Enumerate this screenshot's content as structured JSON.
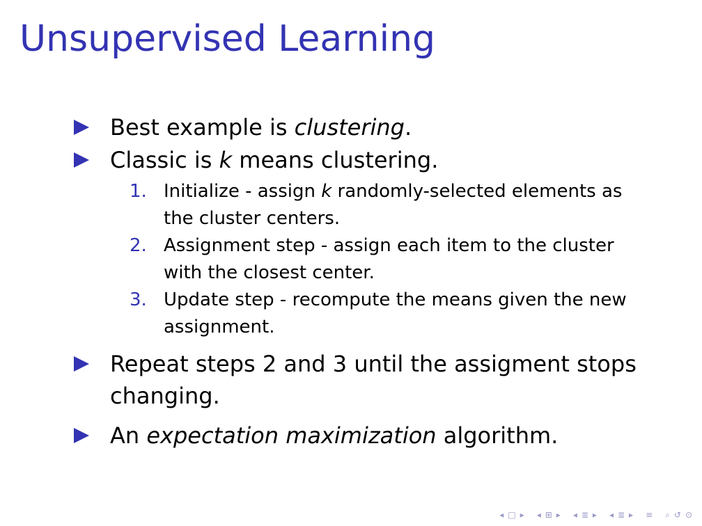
{
  "slide": {
    "title": "Unsupervised Learning",
    "bullets": [
      {
        "parts": [
          "Best example is ",
          "clustering",
          "."
        ]
      },
      {
        "parts": [
          "Classic is ",
          "k",
          " means clustering."
        ]
      },
      {
        "line1": "Repeat steps 2 and 3 until the assigment stops",
        "line2": "changing."
      },
      {
        "parts": [
          "An ",
          "expectation maximization",
          " algorithm."
        ]
      }
    ],
    "steps": [
      {
        "number": "1.",
        "line1_pre": "Initialize - assign ",
        "line1_em": "k",
        "line1_post": " randomly-selected elements as",
        "line2": "the cluster centers."
      },
      {
        "number": "2.",
        "line1": "Assignment step - assign each item to the cluster",
        "line2": "with the closest center."
      },
      {
        "number": "3.",
        "line1": "Update step - recompute the means given the new",
        "line2": "assignment."
      }
    ]
  },
  "colors": {
    "accent": "#3333B3",
    "text": "#000000",
    "nav": "#9a9ac8"
  },
  "nav_icons": [
    "prev-icon",
    "frame-icon",
    "next-icon",
    "prev-icon",
    "subsection-icon",
    "next-icon",
    "prev-icon",
    "section-icon",
    "next-icon",
    "prev-icon",
    "section-icon",
    "next-icon",
    "align-icon",
    "search-icon",
    "undo-icon",
    "zoom-icon"
  ]
}
